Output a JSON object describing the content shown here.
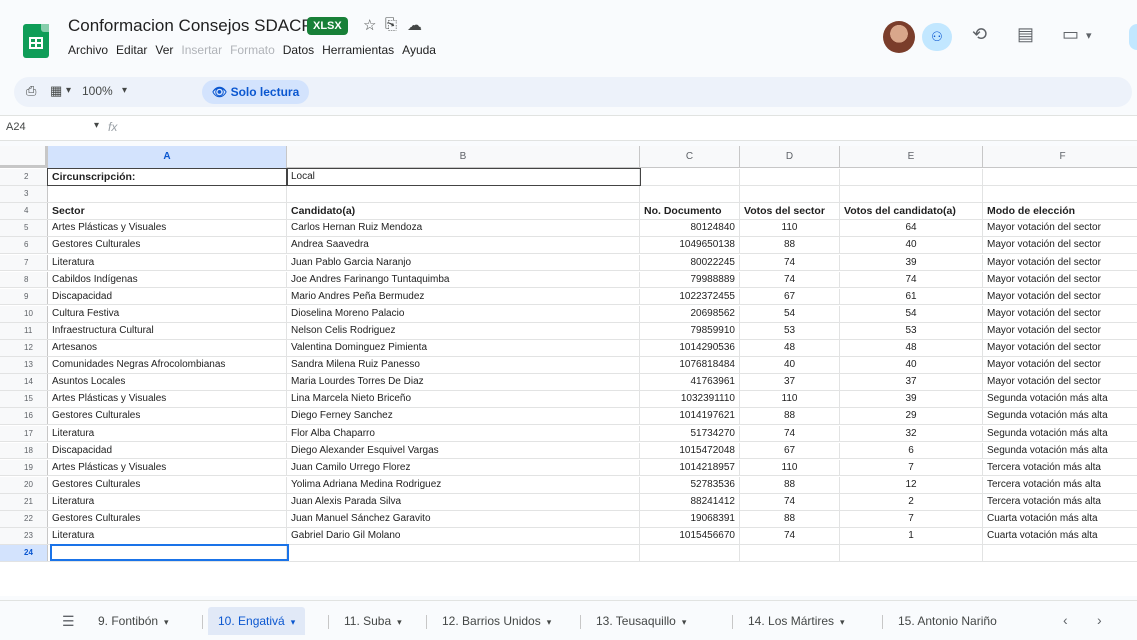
{
  "header": {
    "title": "Conformacion Consejos SDACP",
    "badge": "XLSX",
    "menu": [
      {
        "label": "Archivo",
        "disabled": false
      },
      {
        "label": "Editar",
        "disabled": false
      },
      {
        "label": "Ver",
        "disabled": false
      },
      {
        "label": "Insertar",
        "disabled": true
      },
      {
        "label": "Formato",
        "disabled": true
      },
      {
        "label": "Datos",
        "disabled": false
      },
      {
        "label": "Herramientas",
        "disabled": false
      },
      {
        "label": "Ayuda",
        "disabled": false
      }
    ]
  },
  "toolbar": {
    "zoom": "100%",
    "readonly_label": "Solo lectura"
  },
  "formula_bar": {
    "cell_ref": "A24",
    "fx": "fx"
  },
  "columns": [
    "A",
    "B",
    "C",
    "D",
    "E",
    "F"
  ],
  "active_column": "A",
  "rows": [
    {
      "num": "2",
      "cells": [
        "Circunscripción:",
        "Local",
        "",
        "",
        "",
        ""
      ],
      "type": "label"
    },
    {
      "num": "3",
      "cells": [
        "",
        "",
        "",
        "",
        "",
        ""
      ],
      "type": "empty"
    },
    {
      "num": "4",
      "cells": [
        "Sector",
        "Candidato(a)",
        "No. Documento",
        "Votos del sector",
        "Votos del candidato(a)",
        "Modo de elección"
      ],
      "type": "header"
    },
    {
      "num": "5",
      "cells": [
        "Artes Plásticas y Visuales",
        "Carlos Hernan Ruiz Mendoza",
        "80124840",
        "110",
        "64",
        "Mayor votación del sector"
      ]
    },
    {
      "num": "6",
      "cells": [
        "Gestores Culturales",
        "Andrea Saavedra",
        "1049650138",
        "88",
        "40",
        "Mayor votación del sector"
      ]
    },
    {
      "num": "7",
      "cells": [
        "Literatura",
        "Juan Pablo Garcia Naranjo",
        "80022245",
        "74",
        "39",
        "Mayor votación del sector"
      ]
    },
    {
      "num": "8",
      "cells": [
        "Cabildos Indígenas",
        "Joe Andres Farinango Tuntaquimba",
        "79988889",
        "74",
        "74",
        "Mayor votación del sector"
      ]
    },
    {
      "num": "9",
      "cells": [
        "Discapacidad",
        "Mario Andres Peña Bermudez",
        "1022372455",
        "67",
        "61",
        "Mayor votación del sector"
      ]
    },
    {
      "num": "10",
      "cells": [
        "Cultura Festiva",
        "Dioselina Moreno Palacio",
        "20698562",
        "54",
        "54",
        "Mayor votación del sector"
      ]
    },
    {
      "num": "11",
      "cells": [
        "Infraestructura Cultural",
        "Nelson Celis Rodriguez",
        "79859910",
        "53",
        "53",
        "Mayor votación del sector"
      ]
    },
    {
      "num": "12",
      "cells": [
        "Artesanos",
        "Valentina Dominguez Pimienta",
        "1014290536",
        "48",
        "48",
        "Mayor votación del sector"
      ]
    },
    {
      "num": "13",
      "cells": [
        "Comunidades Negras Afrocolombianas",
        "Sandra Milena Ruiz Panesso",
        "1076818484",
        "40",
        "40",
        "Mayor votación del sector"
      ]
    },
    {
      "num": "14",
      "cells": [
        "Asuntos Locales",
        "Maria Lourdes Torres De Diaz",
        "41763961",
        "37",
        "37",
        "Mayor votación del sector"
      ]
    },
    {
      "num": "15",
      "cells": [
        "Artes Plásticas y Visuales",
        "Lina Marcela Nieto Briceño",
        "1032391110",
        "110",
        "39",
        "Segunda votación más alta"
      ]
    },
    {
      "num": "16",
      "cells": [
        "Gestores Culturales",
        "Diego Ferney Sanchez",
        "1014197621",
        "88",
        "29",
        "Segunda votación más alta"
      ]
    },
    {
      "num": "17",
      "cells": [
        "Literatura",
        "Flor Alba Chaparro",
        "51734270",
        "74",
        "32",
        "Segunda votación más alta"
      ]
    },
    {
      "num": "18",
      "cells": [
        "Discapacidad",
        "Diego Alexander Esquivel Vargas",
        "1015472048",
        "67",
        "6",
        "Segunda votación más alta"
      ]
    },
    {
      "num": "19",
      "cells": [
        "Artes Plásticas y Visuales",
        "Juan Camilo Urrego Florez",
        "1014218957",
        "110",
        "7",
        "Tercera votación más alta"
      ]
    },
    {
      "num": "20",
      "cells": [
        "Gestores Culturales",
        "Yolima Adriana Medina Rodriguez",
        "52783536",
        "88",
        "12",
        "Tercera votación más alta"
      ]
    },
    {
      "num": "21",
      "cells": [
        "Literatura",
        "Juan Alexis Parada Silva",
        "88241412",
        "74",
        "2",
        "Tercera votación más alta"
      ]
    },
    {
      "num": "22",
      "cells": [
        "Gestores Culturales",
        "Juan Manuel Sánchez Garavito",
        "19068391",
        "88",
        "7",
        "Cuarta votación más alta"
      ]
    },
    {
      "num": "23",
      "cells": [
        "Literatura",
        "Gabriel Dario Gil Molano",
        "1015456670",
        "74",
        "1",
        "Cuarta votación más alta"
      ]
    },
    {
      "num": "24",
      "cells": [
        "",
        "",
        "",
        "",
        "",
        ""
      ],
      "type": "active"
    }
  ],
  "sheet_tabs": [
    {
      "label": "9. Fontibón",
      "active": false
    },
    {
      "label": "10. Engativá",
      "active": true
    },
    {
      "label": "11. Suba",
      "active": false
    },
    {
      "label": "12. Barrios Unidos",
      "active": false
    },
    {
      "label": "13. Teusaquillo",
      "active": false
    },
    {
      "label": "14. Los Mártires",
      "active": false
    },
    {
      "label": "15. Antonio Nariño",
      "active": false
    }
  ],
  "colors": {
    "accent": "#0b57d0",
    "brand": "#0f9d58",
    "badge": "#188038",
    "selection": "#1a73e8"
  }
}
